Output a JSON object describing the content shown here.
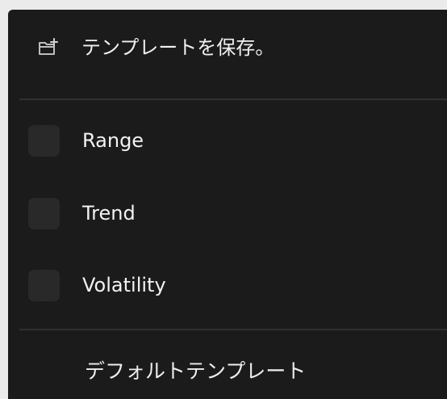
{
  "menu": {
    "save_template": {
      "icon": "folder-plus-icon",
      "label": "テンプレートを保存。"
    },
    "templates": [
      {
        "label": "Range",
        "checked": false
      },
      {
        "label": "Trend",
        "checked": false
      },
      {
        "label": "Volatility",
        "checked": false
      }
    ],
    "default_template": {
      "label": "デフォルトテンプレート"
    }
  }
}
